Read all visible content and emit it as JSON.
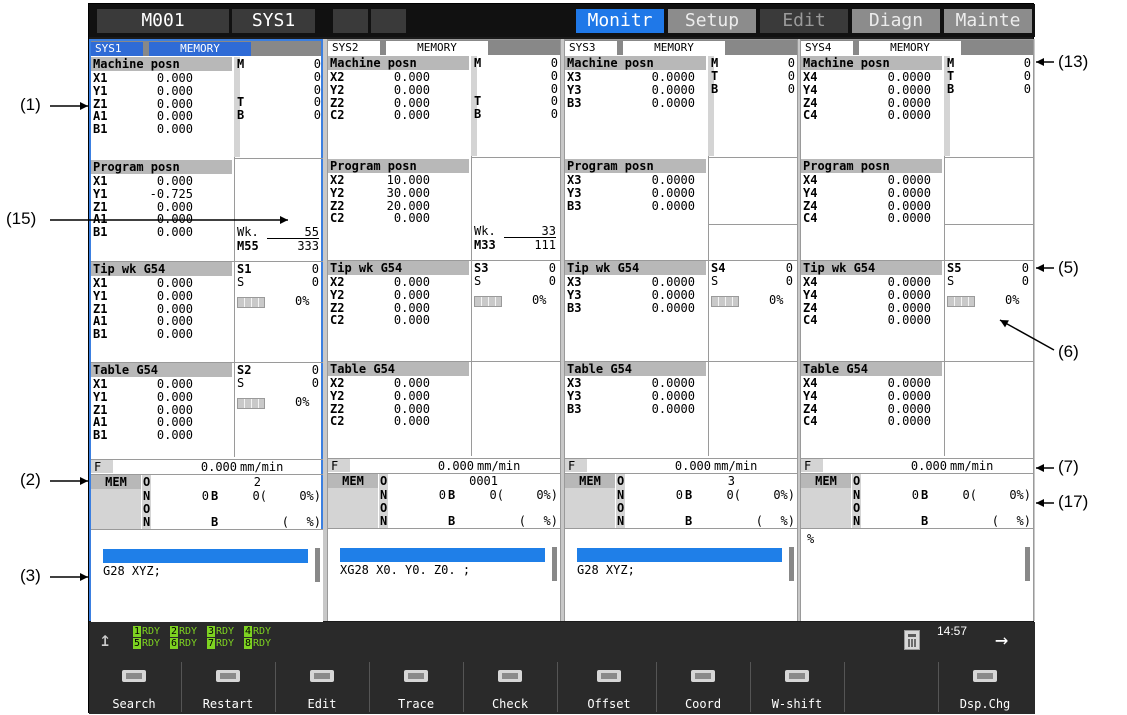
{
  "topbar": {
    "sys_label": "M001",
    "sys_name": "SYS1",
    "tabs": [
      "Monitr",
      "Setup",
      "Edit",
      "Diagn",
      "Mainte"
    ]
  },
  "panels": [
    {
      "sys": "SYS1",
      "mode": "MEMORY",
      "active": true,
      "machine_title": "Machine posn",
      "machine_axes": [
        "X1",
        "Y1",
        "Z1",
        "A1",
        "B1"
      ],
      "machine_vals": [
        "0.000",
        "0.000",
        "0.000",
        "0.000",
        "0.000"
      ],
      "mtb": [
        {
          "k": "M",
          "v": "0"
        },
        {
          "k": "",
          "v": "0"
        },
        {
          "k": "",
          "v": "0"
        },
        {
          "k": "T",
          "v": "0"
        },
        {
          "k": "B",
          "v": "0"
        }
      ],
      "prog_title": "Program posn",
      "prog_axes": [
        "X1",
        "Y1",
        "Z1",
        "A1",
        "B1"
      ],
      "prog_vals": [
        "0.000",
        "-0.725",
        "0.000",
        "0.000",
        "0.000"
      ],
      "wk_label": "Wk.",
      "wk_val": "55",
      "m_label": "M55",
      "m_val": "333",
      "tip_title": "Tip wk G54",
      "tip_axes": [
        "X1",
        "Y1",
        "Z1",
        "A1",
        "B1"
      ],
      "tip_vals": [
        "0.000",
        "0.000",
        "0.000",
        "0.000",
        "0.000"
      ],
      "sp1_label": "S1",
      "sp1_val": "0",
      "s_label": "S",
      "s_val": "0",
      "sp_pct": "0%",
      "tbl_title": "Table  G54",
      "tbl_axes": [
        "X1",
        "Y1",
        "Z1",
        "A1",
        "B1"
      ],
      "tbl_vals": [
        "0.000",
        "0.000",
        "0.000",
        "0.000",
        "0.000"
      ],
      "sp2_label": "S2",
      "sp2_val": "0",
      "s2_label": "S",
      "s2_val": "0",
      "sp2_pct": "0%",
      "feed_label": "F",
      "feed_val": "0.000",
      "feed_unit": "mm/min",
      "mem": "MEM",
      "o_label": "O",
      "o_val": "2",
      "n_label": "N",
      "n_val": "0",
      "b_label": "B",
      "b_val": "0(",
      "b_pct": "0%)",
      "o2_label": "O",
      "n2_label": "N",
      "b2_label": "B",
      "b2_paren": "(",
      "b2_pct": "%)",
      "program_line": "G28 XYZ;"
    },
    {
      "sys": "SYS2",
      "mode": "MEMORY",
      "active": false,
      "machine_title": "Machine posn",
      "machine_axes": [
        "X2",
        "Y2",
        "Z2",
        "C2"
      ],
      "machine_vals": [
        "0.000",
        "0.000",
        "0.000",
        "0.000"
      ],
      "mtb": [
        {
          "k": "M",
          "v": "0"
        },
        {
          "k": "",
          "v": "0"
        },
        {
          "k": "",
          "v": "0"
        },
        {
          "k": "T",
          "v": "0"
        },
        {
          "k": "B",
          "v": "0"
        }
      ],
      "prog_title": "Program posn",
      "prog_axes": [
        "X2",
        "Y2",
        "Z2",
        "C2"
      ],
      "prog_vals": [
        "10.000",
        "30.000",
        "20.000",
        "0.000"
      ],
      "wk_label": "Wk.",
      "wk_val": "33",
      "m_label": "M33",
      "m_val": "111",
      "tip_title": "Tip wk G54",
      "tip_axes": [
        "X2",
        "Y2",
        "Z2",
        "C2"
      ],
      "tip_vals": [
        "0.000",
        "0.000",
        "0.000",
        "0.000"
      ],
      "sp1_label": "S3",
      "sp1_val": "0",
      "s_label": "S",
      "s_val": "0",
      "sp_pct": "0%",
      "tbl_title": "Table  G54",
      "tbl_axes": [
        "X2",
        "Y2",
        "Z2",
        "C2"
      ],
      "tbl_vals": [
        "0.000",
        "0.000",
        "0.000",
        "0.000"
      ],
      "feed_label": "F",
      "feed_val": "0.000",
      "feed_unit": "mm/min",
      "mem": "MEM",
      "o_label": "O",
      "o_val": "0001",
      "n_label": "N",
      "n_val": "0",
      "b_label": "B",
      "b_val": "0(",
      "b_pct": "0%)",
      "o2_label": "O",
      "n2_label": "N",
      "b2_label": "B",
      "b2_paren": "(",
      "b2_pct": "%)",
      "program_line": "XG28 X0. Y0. Z0. ;"
    },
    {
      "sys": "SYS3",
      "mode": "MEMORY",
      "active": false,
      "machine_title": "Machine posn",
      "machine_axes": [
        "X3",
        "Y3",
        "B3"
      ],
      "machine_vals": [
        "0.0000",
        "0.0000",
        "0.0000"
      ],
      "mtb": [
        {
          "k": "M",
          "v": "0"
        },
        {
          "k": "T",
          "v": "0"
        },
        {
          "k": "B",
          "v": "0"
        }
      ],
      "prog_title": "Program posn",
      "prog_axes": [
        "X3",
        "Y3",
        "B3"
      ],
      "prog_vals": [
        "0.0000",
        "0.0000",
        "0.0000"
      ],
      "tip_title": "Tip wk G54",
      "tip_axes": [
        "X3",
        "Y3",
        "B3"
      ],
      "tip_vals": [
        "0.0000",
        "0.0000",
        "0.0000"
      ],
      "sp1_label": "S4",
      "sp1_val": "0",
      "s_label": "S",
      "s_val": "0",
      "sp_pct": "0%",
      "tbl_title": "Table  G54",
      "tbl_axes": [
        "X3",
        "Y3",
        "B3"
      ],
      "tbl_vals": [
        "0.0000",
        "0.0000",
        "0.0000"
      ],
      "feed_label": "F",
      "feed_val": "0.000",
      "feed_unit": "mm/min",
      "mem": "MEM",
      "o_label": "O",
      "o_val": "3",
      "n_label": "N",
      "n_val": "0",
      "b_label": "B",
      "b_val": "0(",
      "b_pct": "0%)",
      "o2_label": "O",
      "n2_label": "N",
      "b2_label": "B",
      "b2_paren": "(",
      "b2_pct": "%)",
      "program_line": "G28 XYZ;"
    },
    {
      "sys": "SYS4",
      "mode": "MEMORY",
      "active": false,
      "machine_title": "Machine posn",
      "machine_axes": [
        "X4",
        "Y4",
        "Z4",
        "C4"
      ],
      "machine_vals": [
        "0.0000",
        "0.0000",
        "0.0000",
        "0.0000"
      ],
      "mtb": [
        {
          "k": "M",
          "v": "0"
        },
        {
          "k": "T",
          "v": "0"
        },
        {
          "k": "B",
          "v": "0"
        }
      ],
      "prog_title": "Program posn",
      "prog_axes": [
        "X4",
        "Y4",
        "Z4",
        "C4"
      ],
      "prog_vals": [
        "0.0000",
        "0.0000",
        "0.0000",
        "0.0000"
      ],
      "tip_title": "Tip wk G54",
      "tip_axes": [
        "X4",
        "Y4",
        "Z4",
        "C4"
      ],
      "tip_vals": [
        "0.0000",
        "0.0000",
        "0.0000",
        "0.0000"
      ],
      "sp1_label": "S5",
      "sp1_val": "0",
      "s_label": "S",
      "s_val": "0",
      "sp_pct": "0%",
      "tbl_title": "Table  G54",
      "tbl_axes": [
        "X4",
        "Y4",
        "Z4",
        "C4"
      ],
      "tbl_vals": [
        "0.0000",
        "0.0000",
        "0.0000",
        "0.0000"
      ],
      "feed_label": "F",
      "feed_val": "0.000",
      "feed_unit": "mm/min",
      "mem": "MEM",
      "o_label": "O",
      "o_val": "",
      "n_label": "N",
      "n_val": "0",
      "b_label": "B",
      "b_val": "0(",
      "b_pct": "0%)",
      "o2_label": "O",
      "n2_label": "N",
      "b2_label": "B",
      "b2_paren": "(",
      "b2_pct": "%)",
      "program_line": "%"
    }
  ],
  "status": {
    "rdy": [
      {
        "n": "1",
        "t": "RDY"
      },
      {
        "n": "2",
        "t": "RDY"
      },
      {
        "n": "3",
        "t": "RDY"
      },
      {
        "n": "4",
        "t": "RDY"
      },
      {
        "n": "5",
        "t": "RDY"
      },
      {
        "n": "6",
        "t": "RDY"
      },
      {
        "n": "7",
        "t": "RDY"
      },
      {
        "n": "8",
        "t": "RDY"
      }
    ],
    "time": "14:57"
  },
  "fkeys": [
    "Search",
    "Restart",
    "Edit",
    "Trace",
    "Check",
    "Offset",
    "Coord",
    "W-shift",
    "",
    "Dsp.Chg"
  ],
  "callouts": [
    "(1)",
    "(2)",
    "(3)",
    "(15)",
    "(13)",
    "(5)",
    "(6)",
    "(7)",
    "(17)"
  ],
  "colors": {
    "accent": "#1f78e8",
    "bg": "#1b1b1b",
    "rdy": "#7ed321"
  }
}
